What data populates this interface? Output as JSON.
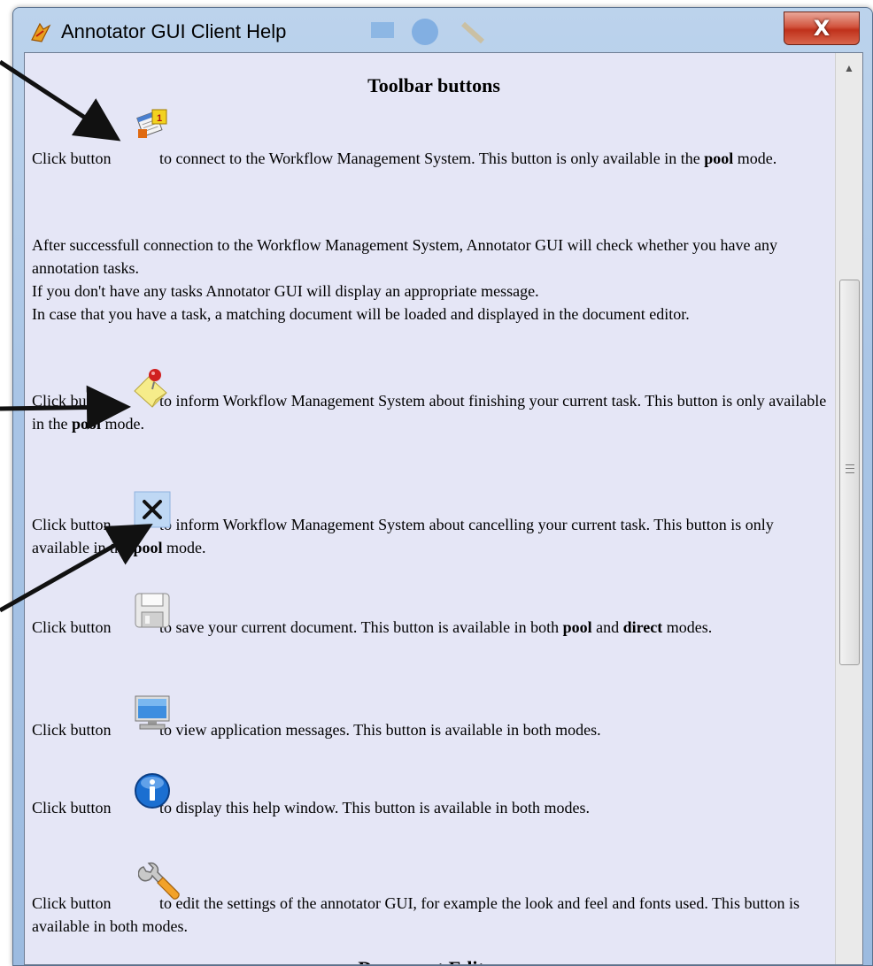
{
  "window": {
    "title": "Annotator GUI Client Help",
    "close_label": "X"
  },
  "help": {
    "section_toolbar": "Toolbar buttons",
    "p1": {
      "pre": "Click button",
      "post": "to connect to the Workflow Management System. This button is only available in the",
      "bold": "pool",
      "end": "mode."
    },
    "p2": {
      "l1": "After successfull connection to the Workflow Management System, Annotator GUI will check whether you have any annotation tasks.",
      "l2": "If you don't have any tasks Annotator GUI will display an appropriate message.",
      "l3": "In case that you have a task, a matching document will be loaded and displayed in the document editor."
    },
    "p3": {
      "pre": "Click button",
      "post": "to inform Workflow Management System about finishing your current task. This button is only available in the",
      "bold": "pool",
      "end": "mode."
    },
    "p4": {
      "pre": "Click button",
      "post": "to inform Workflow Management System about cancelling your current task. This button is only available in the",
      "bold": "pool",
      "end": "mode."
    },
    "p5": {
      "pre": "Click button",
      "post": "to save your current document. This button is available in both",
      "bold1": "pool",
      "mid": "and",
      "bold2": "direct",
      "end": "modes."
    },
    "p6": {
      "pre": "Click button",
      "post": "to view application messages. This button is available in both modes."
    },
    "p7": {
      "pre": "Click button",
      "post": "to display this help window. This button is available in both modes."
    },
    "p8": {
      "pre": "Click button",
      "post": "to edit the settings of the annotator GUI, for example the look and feel and fonts used. This button is available in both modes."
    },
    "section_editor": "Document Editor"
  },
  "icons": {
    "connect": "calendar-connect-icon",
    "finish": "sticky-note-pin-icon",
    "cancel": "x-cancel-icon",
    "save": "floppy-disk-icon",
    "messages": "monitor-icon",
    "help": "info-icon",
    "settings": "wrench-icon"
  },
  "colors": {
    "content_bg": "#e5e6f6",
    "close_red": "#c0311b",
    "info_blue": "#1b6fd1"
  }
}
